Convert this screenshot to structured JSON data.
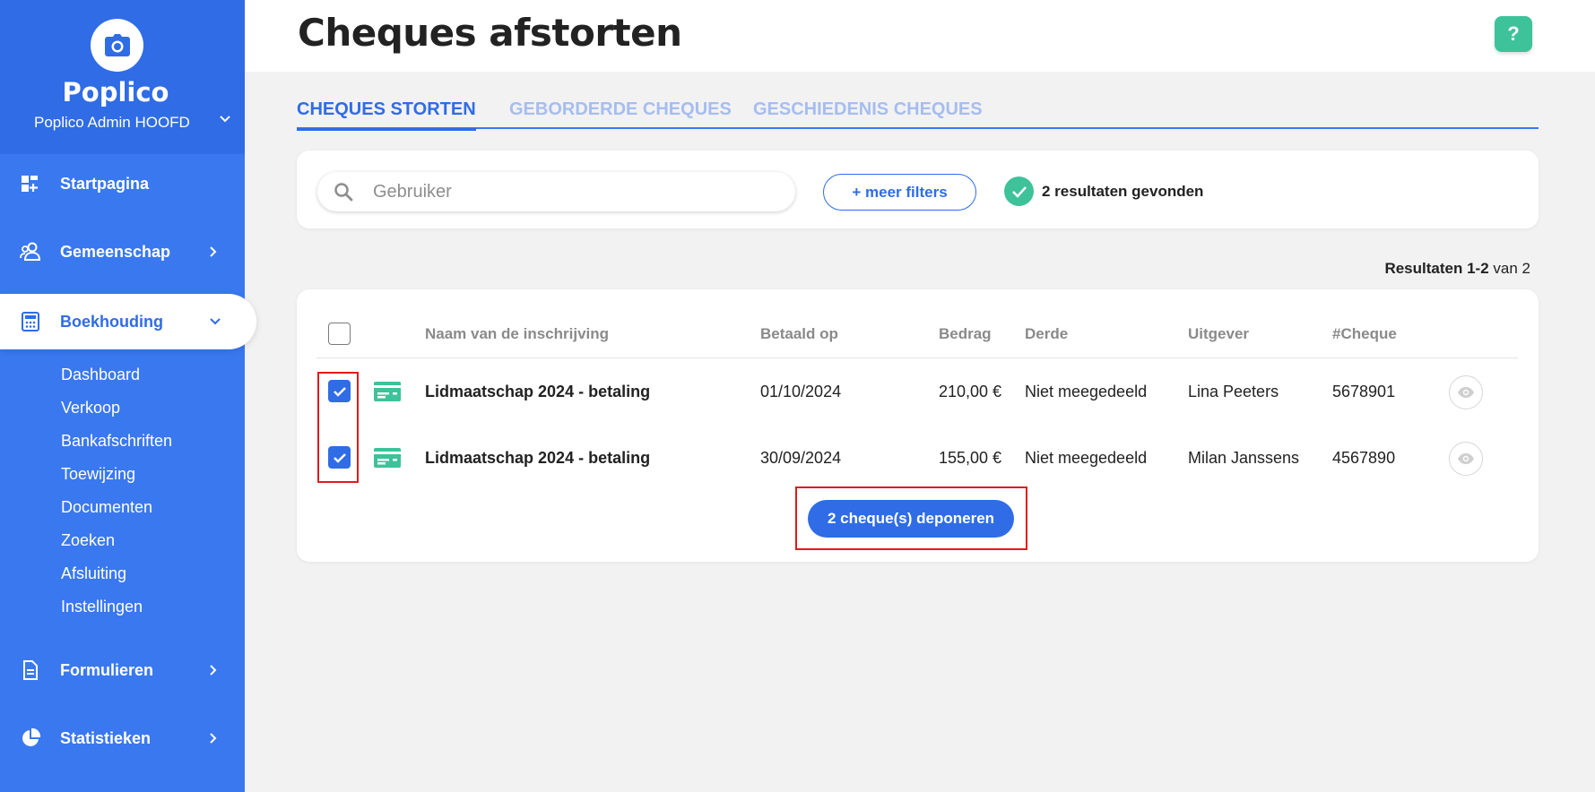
{
  "sidebar": {
    "brand_name": "Poplico",
    "account": "Poplico Admin HOOFD",
    "nav": {
      "home": "Startpagina",
      "community": "Gemeenschap",
      "accounting": "Boekhouding",
      "forms": "Formulieren",
      "stats": "Statistieken"
    },
    "submenu": [
      "Dashboard",
      "Verkoop",
      "Bankafschriften",
      "Toewijzing",
      "Documenten",
      "Zoeken",
      "Afsluiting",
      "Instellingen"
    ]
  },
  "header": {
    "title": "Cheques afstorten",
    "help_label": "?"
  },
  "tabs": [
    "CHEQUES STORTEN",
    "GEBORDERDE CHEQUES",
    "GESCHIEDENIS CHEQUES"
  ],
  "filters": {
    "search_placeholder": "Gebruiker",
    "more_filters": "+ meer filters",
    "results_found": "2 resultaten gevonden"
  },
  "results_count": {
    "label": "Resultaten",
    "range": "1-2",
    "suffix": "van 2"
  },
  "table": {
    "headers": [
      "Naam van de inschrijving",
      "Betaald op",
      "Bedrag",
      "Derde",
      "Uitgever",
      "#Cheque"
    ],
    "rows": [
      {
        "name": "Lidmaatschap 2024 - betaling",
        "paid_on": "01/10/2024",
        "amount": "210,00 €",
        "third_party": "Niet meegedeeld",
        "issuer": "Lina Peeters",
        "cheque": "5678901",
        "checked": true
      },
      {
        "name": "Lidmaatschap 2024 - betaling",
        "paid_on": "30/09/2024",
        "amount": "155,00 €",
        "third_party": "Niet meegedeeld",
        "issuer": "Milan Janssens",
        "cheque": "4567890",
        "checked": true
      }
    ],
    "deposit_label": "2 cheque(s) deponeren"
  },
  "colors": {
    "primary": "#2f6ce6",
    "sidebar": "#3a78f0",
    "success": "#3ec29a",
    "highlight": "#e01b1b"
  },
  "icons": [
    "camera-icon",
    "dashboard-icon",
    "community-icon",
    "calculator-icon",
    "document-icon",
    "pie-chart-icon",
    "search-icon",
    "check-icon",
    "cheque-icon",
    "eye-icon",
    "chevron-down-icon",
    "chevron-right-icon"
  ]
}
